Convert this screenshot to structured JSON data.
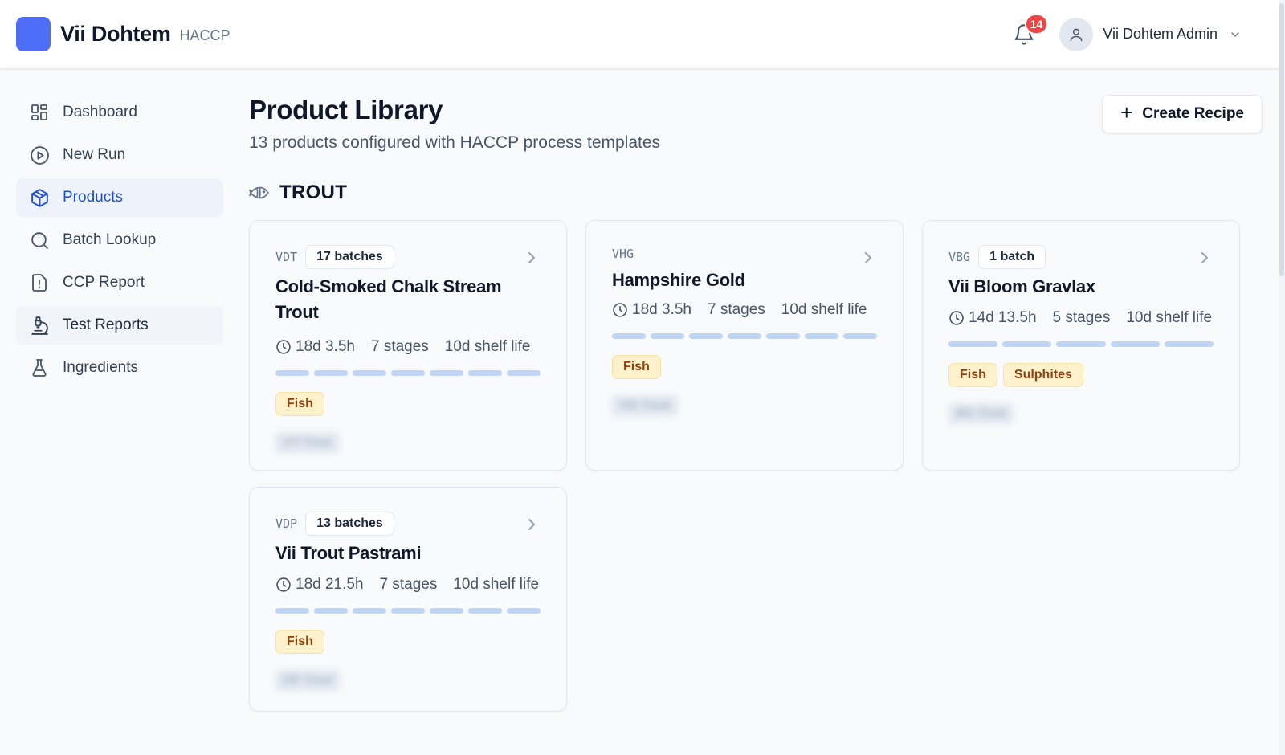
{
  "app": {
    "name": "Vii Dohtem",
    "subtitle": "HACCP",
    "accent": "#4f6ef7"
  },
  "header": {
    "notifications": {
      "count": "14",
      "icon": "bell-icon"
    },
    "user": {
      "name": "Vii Dohtem Admin",
      "icon": "user-icon"
    }
  },
  "sidebar": {
    "items": [
      {
        "label": "Dashboard",
        "icon": "dashboard-grid-icon",
        "state": "default"
      },
      {
        "label": "New Run",
        "icon": "play-circle-icon",
        "state": "default"
      },
      {
        "label": "Products",
        "icon": "package-icon",
        "state": "active"
      },
      {
        "label": "Batch Lookup",
        "icon": "search-icon",
        "state": "default"
      },
      {
        "label": "CCP Report",
        "icon": "alert-document-icon",
        "state": "default"
      },
      {
        "label": "Test Reports",
        "icon": "microscope-icon",
        "state": "hover"
      },
      {
        "label": "Ingredients",
        "icon": "flask-icon",
        "state": "default"
      }
    ]
  },
  "main": {
    "title": "Product Library",
    "subtitle": "13 products configured with HACCP process templates",
    "create_button": "Create Recipe",
    "section": {
      "title": "TROUT",
      "icon": "fish-icon"
    },
    "products": [
      {
        "code": "VDT",
        "batches": "17 batches",
        "name": "Cold-Smoked Chalk Stream Trout",
        "duration": "18d 3.5h",
        "stages_label": "7 stages",
        "stage_count": 7,
        "shelf_life": "10d shelf life",
        "tags": [
          "Fish"
        ],
        "footer_blurred": "UT-Trout"
      },
      {
        "code": "VHG",
        "batches": "",
        "name": "Hampshire Gold",
        "duration": "18d 3.5h",
        "stages_label": "7 stages",
        "stage_count": 7,
        "shelf_life": "10d shelf life",
        "tags": [
          "Fish"
        ],
        "footer_blurred": "HG-Trout"
      },
      {
        "code": "VBG",
        "batches": "1 batch",
        "name": "Vii Bloom Gravlax",
        "duration": "14d 13.5h",
        "stages_label": "5 stages",
        "stage_count": 5,
        "shelf_life": "10d shelf life",
        "tags": [
          "Fish",
          "Sulphites"
        ],
        "footer_blurred": "BG-Trout"
      },
      {
        "code": "VDP",
        "batches": "13 batches",
        "name": "Vii Trout Pastrami",
        "duration": "18d 21.5h",
        "stages_label": "7 stages",
        "stage_count": 7,
        "shelf_life": "10d shelf life",
        "tags": [
          "Fish"
        ],
        "footer_blurred": "DP-Trout"
      }
    ]
  }
}
